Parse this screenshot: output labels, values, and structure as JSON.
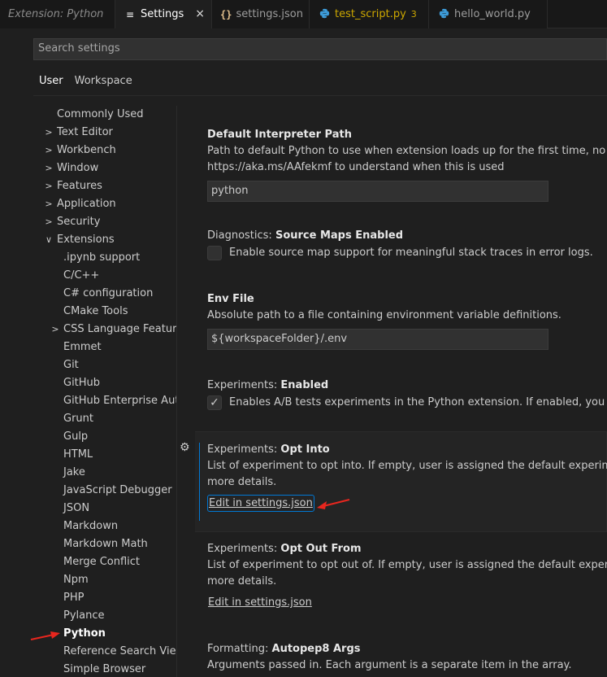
{
  "tabs": [
    {
      "label": "Extension: Python"
    },
    {
      "label": "Settings",
      "close": "×"
    },
    {
      "label": "settings.json",
      "icon": "{}"
    },
    {
      "label": "test_script.py",
      "badge": "3"
    },
    {
      "label": "hello_world.py"
    }
  ],
  "search": {
    "placeholder": "Search settings"
  },
  "scope_tabs": [
    "User",
    "Workspace"
  ],
  "toc": [
    "Commonly Used",
    "Text Editor",
    "Workbench",
    "Window",
    "Features",
    "Application",
    "Security",
    "Extensions",
    ".ipynb support",
    "C/C++",
    "C# configuration",
    "CMake Tools",
    "CSS Language Features",
    "Emmet",
    "Git",
    "GitHub",
    "GitHub Enterprise Aut...",
    "Grunt",
    "Gulp",
    "HTML",
    "Jake",
    "JavaScript Debugger",
    "JSON",
    "Markdown",
    "Markdown Math",
    "Merge Conflict",
    "Npm",
    "PHP",
    "Pylance",
    "Python",
    "Reference Search View",
    "Simple Browser"
  ],
  "settings": {
    "interpreter": {
      "title": "Default Interpreter Path",
      "desc1": "Path to default Python to use when extension loads up for the first time, no longer use",
      "desc2": "https://aka.ms/AAfekmf to understand when this is used",
      "value": "python"
    },
    "diagnostics": {
      "category": "Diagnostics: ",
      "title": "Source Maps Enabled",
      "checkbox_label": "Enable source map support for meaningful stack traces in error logs.",
      "checked": false
    },
    "env_file": {
      "title": "Env File",
      "desc": "Absolute path to a file containing environment variable definitions.",
      "value": "${workspaceFolder}/.env"
    },
    "exp_enabled": {
      "category": "Experiments: ",
      "title": "Enabled",
      "checkbox_label": "Enables A/B tests experiments in the Python extension. If enabled, you may get in",
      "checked": true
    },
    "opt_into": {
      "category": "Experiments: ",
      "title": "Opt Into",
      "desc1": "List of experiment to opt into. If empty, user is assigned the default experiment groups",
      "desc2": "more details.",
      "link": "Edit in settings.json"
    },
    "opt_out": {
      "category": "Experiments: ",
      "title": "Opt Out From",
      "desc1": "List of experiment to opt out of. If empty, user is assigned the default experiment grou",
      "desc2": "more details.",
      "link": "Edit in settings.json"
    },
    "autopep8": {
      "category": "Formatting: ",
      "title": "Autopep8 Args",
      "desc": "Arguments passed in. Each argument is a separate item in the array."
    }
  },
  "colors": {
    "accent": "#0078d4",
    "annotation_arrow": "#e8261e"
  }
}
